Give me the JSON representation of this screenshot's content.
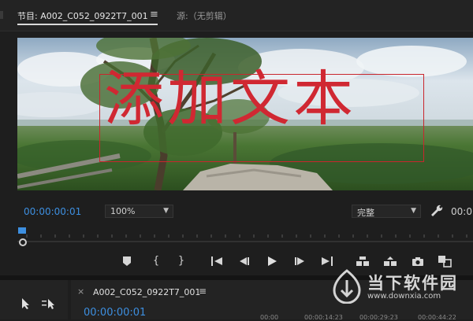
{
  "tabs": [
    {
      "label": "节目: A002_C052_0922T7_001",
      "active": true
    },
    {
      "label": "源:（无剪辑）",
      "active": false
    }
  ],
  "tab_menu_icon": "hamburger-icon",
  "overlay": {
    "text": "添加文本",
    "color": "#d02832"
  },
  "controls": {
    "timecode": "00:00:00:01",
    "zoom": "100%",
    "quality": "完整",
    "timecode_right": "00:0"
  },
  "transport": [
    {
      "name": "add-marker-button",
      "icon": "marker-icon",
      "glyph": "⬟"
    },
    {
      "name": "mark-in-button",
      "icon": "mark-in-icon",
      "glyph": "{"
    },
    {
      "name": "mark-out-button",
      "icon": "mark-out-icon",
      "glyph": "}"
    },
    {
      "name": "go-to-in-button",
      "icon": "go-to-in-icon",
      "glyph": "⇤"
    },
    {
      "name": "step-back-button",
      "icon": "step-back-icon",
      "glyph": "◀▏"
    },
    {
      "name": "play-button",
      "icon": "play-icon",
      "glyph": "▶"
    },
    {
      "name": "step-forward-button",
      "icon": "step-forward-icon",
      "glyph": "▕▶"
    },
    {
      "name": "go-to-out-button",
      "icon": "go-to-out-icon",
      "glyph": "⇥"
    },
    {
      "name": "lift-button",
      "icon": "lift-icon",
      "glyph": "⏏"
    },
    {
      "name": "extract-button",
      "icon": "extract-icon",
      "glyph": "⏏"
    },
    {
      "name": "export-frame-button",
      "icon": "camera-icon",
      "glyph": "📷"
    },
    {
      "name": "comparison-view-button",
      "icon": "comparison-icon",
      "glyph": "▣"
    }
  ],
  "sequence": {
    "close": "×",
    "tab_label": "A002_C052_0922T7_001",
    "timecode": "00:00:00:01",
    "ruler_labels": [
      "00:00",
      "00:00:14:23",
      "00:00:29:23",
      "00:00:44:22"
    ]
  },
  "watermark": {
    "name": "当下软件园",
    "url": "www.downxia.com"
  },
  "colors": {
    "accent": "#3d8fe0",
    "background": "#1e1e1e",
    "panel": "#232323"
  }
}
